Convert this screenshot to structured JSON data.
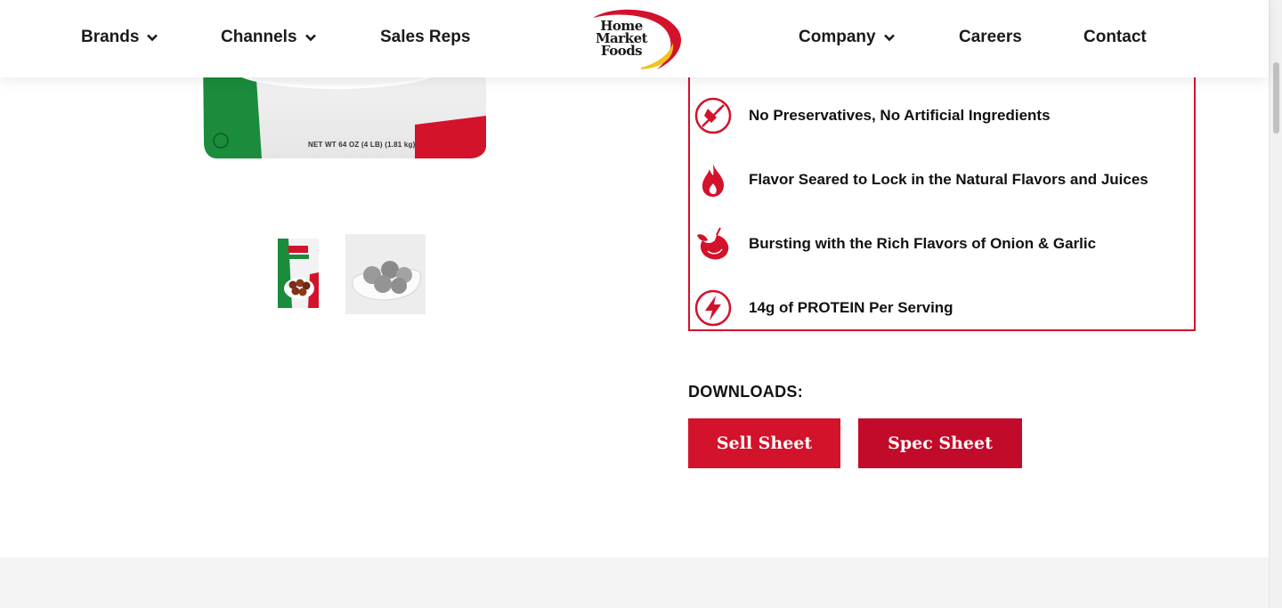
{
  "nav": {
    "brands": "Brands",
    "channels": "Channels",
    "sales_reps": "Sales Reps",
    "company": "Company",
    "careers": "Careers",
    "contact": "Contact"
  },
  "logo": {
    "line1": "Home",
    "line2": "Market",
    "line3": "Foods"
  },
  "product": {
    "bag_label": "NET WT 64 OZ (4 LB) (1.81 kg)"
  },
  "features": [
    {
      "icon": "no-preservatives-icon",
      "text": "No Preservatives, No Artificial Ingredients"
    },
    {
      "icon": "flame-icon",
      "text": "Flavor Seared to Lock in the Natural Flavors and Juices"
    },
    {
      "icon": "onion-garlic-icon",
      "text": "Bursting with the Rich Flavors of Onion & Garlic"
    },
    {
      "icon": "lightning-icon",
      "text": "14g of PROTEIN Per Serving"
    }
  ],
  "downloads": {
    "title": "DOWNLOADS:",
    "sell_sheet": "Sell Sheet",
    "spec_sheet": "Spec Sheet"
  },
  "colors": {
    "brand_red": "#d3122b",
    "dark_red": "#c20a2a",
    "logo_yellow": "#f2c21b"
  }
}
